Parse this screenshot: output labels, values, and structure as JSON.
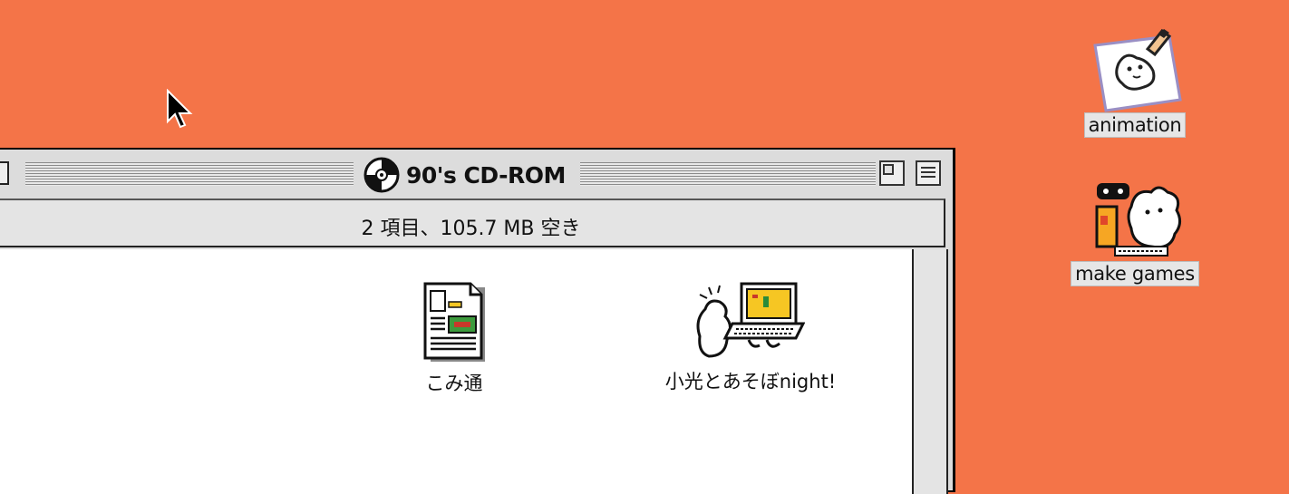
{
  "desktop": {
    "background_color": "#f47448",
    "icons": [
      {
        "label": "animation",
        "icon": "drawing-pad-icon"
      },
      {
        "label": "make games",
        "icon": "game-character-icon"
      }
    ]
  },
  "window": {
    "title": "90's CD-ROM",
    "title_icon": "cd-rom-icon",
    "info": "2 項目、105.7 MB 空き",
    "files": [
      {
        "label": "こみ通",
        "icon": "document-icon"
      },
      {
        "label": "小光とあそぼnight!",
        "icon": "laptop-character-icon"
      }
    ]
  }
}
